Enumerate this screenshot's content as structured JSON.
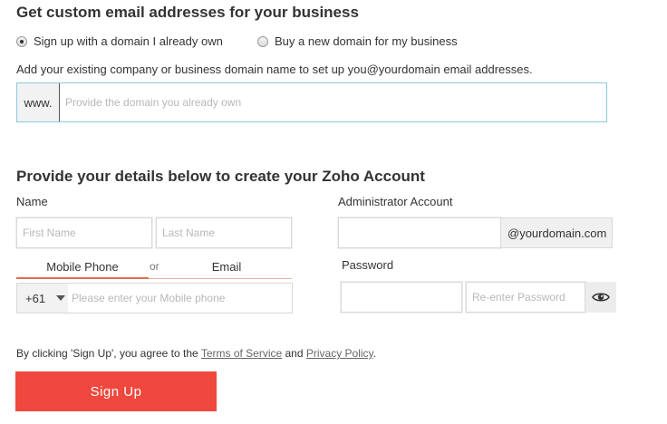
{
  "domain_section": {
    "heading": "Get custom email addresses for your business",
    "option_existing": "Sign up with a domain I already own",
    "option_buy": "Buy a new domain for my business",
    "description": "Add your existing company or business domain name to set up you@yourdomain email addresses.",
    "prefix": "www.",
    "domain_placeholder": "Provide the domain you already own"
  },
  "account_section": {
    "heading": "Provide your details below to create your Zoho Account",
    "name_label": "Name",
    "first_name_placeholder": "First Name",
    "last_name_placeholder": "Last Name",
    "tab_mobile": "Mobile Phone",
    "tab_or": "or",
    "tab_email": "Email",
    "country_code": "+61",
    "phone_placeholder": "Please enter your Mobile phone",
    "admin_label": "Administrator Account",
    "admin_suffix": "@yourdomain.com",
    "password_label": "Password",
    "password_placeholder": "",
    "reenter_placeholder": "Re-enter Password"
  },
  "footer": {
    "terms_prefix": "By clicking 'Sign Up', you agree to the ",
    "terms_link": "Terms of Service",
    "terms_and": " and ",
    "privacy_link": "Privacy Policy",
    "terms_suffix": ".",
    "signup_label": "Sign Up"
  },
  "colors": {
    "signup_button": "#f0483e",
    "active_tab_underline": "#e06c4c",
    "domain_focus_border": "#8cc9dd"
  },
  "icons": {
    "password_toggle": "eye-icon",
    "country_dropdown": "caret-down-icon"
  }
}
